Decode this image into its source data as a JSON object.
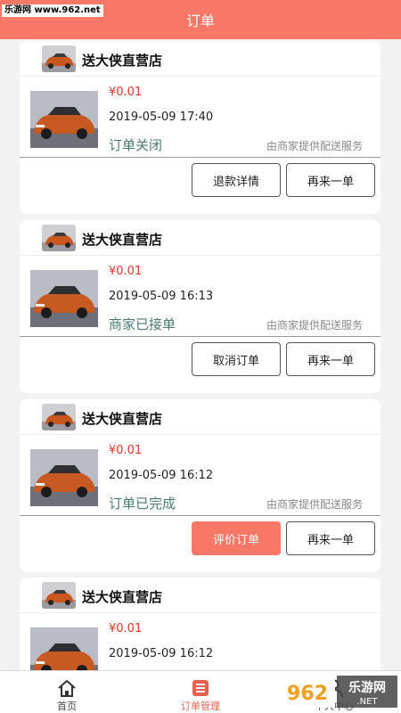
{
  "watermark_top": "乐游网 www.962.net",
  "header": {
    "title": "订单"
  },
  "orders": [
    {
      "shop": "送大侠直营店",
      "price": "¥0.01",
      "date": "2019-05-09 17:40",
      "status": "订单关闭",
      "delivery": "由商家提供配送服务",
      "btn_left": "退款详情",
      "btn_right": "再来一单",
      "btn_left_primary": false
    },
    {
      "shop": "送大侠直营店",
      "price": "¥0.01",
      "date": "2019-05-09 16:13",
      "status": "商家已接单",
      "delivery": "由商家提供配送服务",
      "btn_left": "取消订单",
      "btn_right": "再来一单",
      "btn_left_primary": false
    },
    {
      "shop": "送大侠直营店",
      "price": "¥0.01",
      "date": "2019-05-09 16:12",
      "status": "订单已完成",
      "delivery": "由商家提供配送服务",
      "btn_left": "评价订单",
      "btn_right": "再来一单",
      "btn_left_primary": true
    },
    {
      "shop": "送大侠直营店",
      "price": "¥0.01",
      "date": "2019-05-09 16:12"
    }
  ],
  "tabbar": {
    "items": [
      {
        "label": "首页",
        "icon": "home-icon"
      },
      {
        "label": "订单管理",
        "icon": "order-list-icon",
        "active": true
      },
      {
        "label": "个人中心",
        "icon": "user-icon"
      }
    ]
  },
  "watermark_bottom": {
    "logo": "962",
    "text": "乐游网",
    "url": ".NET"
  },
  "colors": {
    "accent": "#f87868",
    "price": "#d93a2b",
    "status": "#4a7a73"
  }
}
